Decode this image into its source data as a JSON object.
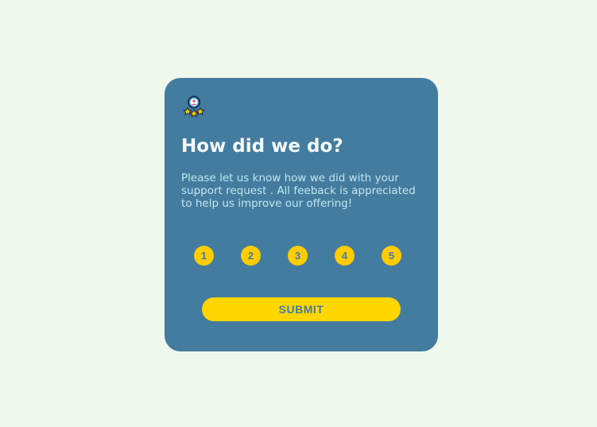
{
  "card": {
    "title": "How did we do?",
    "description": "Please let us know how we did with your support request . All feeback is appreciated to help us improve our offering!",
    "badge_icon": "award-badge-icon"
  },
  "ratings": [
    {
      "label": "1"
    },
    {
      "label": "2"
    },
    {
      "label": "3"
    },
    {
      "label": "4"
    },
    {
      "label": "5"
    }
  ],
  "submit_label": "SUBMIT",
  "colors": {
    "background": "#f0f8ee",
    "card": "#447c9f",
    "accent": "#ffcc00",
    "title": "#f4f9fc",
    "description": "#bfe8f0"
  }
}
